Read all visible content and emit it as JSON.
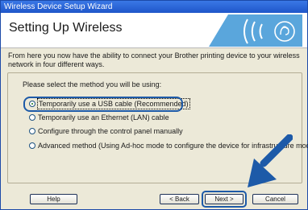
{
  "window": {
    "title": "Wireless Device Setup Wizard"
  },
  "header": {
    "title": "Setting Up Wireless",
    "logo_icon": "wifi-logo-icon"
  },
  "description": "From here you now have the ability to connect your Brother printing device to your wireless network in four different ways.",
  "prompt": "Please select the method you will be using:",
  "options": [
    {
      "label": "Temporarily use a USB cable (Recommended)",
      "selected": true
    },
    {
      "label": "Temporarily use an Ethernet (LAN) cable",
      "selected": false
    },
    {
      "label": "Configure through the control panel manually",
      "selected": false
    },
    {
      "label": "Advanced method (Using Ad-hoc mode to configure the device for infrastructure mode)",
      "selected": false
    }
  ],
  "buttons": {
    "help": "Help",
    "back": "< Back",
    "next": "Next >",
    "cancel": "Cancel"
  },
  "colors": {
    "highlight": "#1d5aa8",
    "titlebar": "#2a63d4",
    "dialog_bg": "#ece9d8"
  }
}
